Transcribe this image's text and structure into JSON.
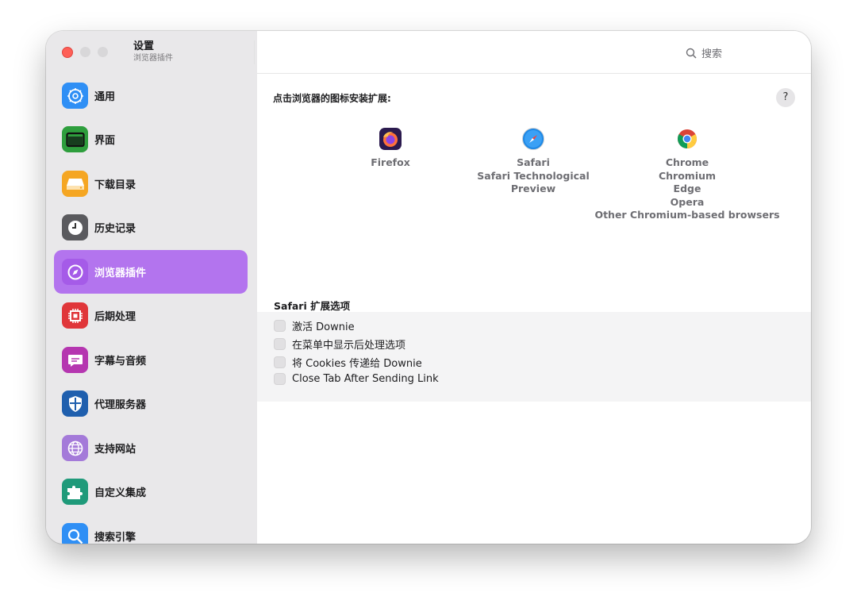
{
  "window": {
    "title": "设置",
    "subtitle": "浏览器插件"
  },
  "search": {
    "label": "搜索"
  },
  "sidebar": {
    "items": [
      {
        "label": "通用",
        "icon": "gear-icon",
        "color": "#2f8ff5",
        "active": false
      },
      {
        "label": "界面",
        "icon": "window-icon",
        "color": "#2e9e3d",
        "active": false
      },
      {
        "label": "下载目录",
        "icon": "drive-icon",
        "color": "#f5a623",
        "active": false
      },
      {
        "label": "历史记录",
        "icon": "clock-icon",
        "color": "#5a5a5e",
        "active": false
      },
      {
        "label": "浏览器插件",
        "icon": "compass-icon",
        "color": "#a55be8",
        "active": true
      },
      {
        "label": "后期处理",
        "icon": "chip-icon",
        "color": "#e0363a",
        "active": false
      },
      {
        "label": "字幕与音频",
        "icon": "speech-bubble-icon",
        "color": "#b536b0",
        "active": false
      },
      {
        "label": "代理服务器",
        "icon": "shield-icon",
        "color": "#1f5fae",
        "active": false
      },
      {
        "label": "支持网站",
        "icon": "globe-icon",
        "color": "#a47ad9",
        "active": false
      },
      {
        "label": "自定义集成",
        "icon": "puzzle-icon",
        "color": "#1f9a7a",
        "active": false
      },
      {
        "label": "搜索引擎",
        "icon": "magnifier-icon",
        "color": "#2f8ff5",
        "active": false
      }
    ]
  },
  "main": {
    "header": "点击浏览器的图标安装扩展:",
    "help_label": "?",
    "browsers": [
      {
        "icon": "firefox-icon",
        "names": [
          "Firefox"
        ]
      },
      {
        "icon": "safari-icon",
        "names": [
          "Safari",
          "Safari Technological Preview"
        ]
      },
      {
        "icon": "chrome-icon",
        "names": [
          "Chrome",
          "Chromium",
          "Edge",
          "Opera",
          "Other Chromium-based browsers"
        ]
      }
    ],
    "safari_section_title": "Safari 扩展选项",
    "options": [
      {
        "label": "激活 Downie",
        "checked": false
      },
      {
        "label": "在菜单中显示后处理选项",
        "checked": false
      },
      {
        "label": "将 Cookies 传递给 Downie",
        "checked": false
      },
      {
        "label": "Close Tab After Sending Link",
        "checked": false
      }
    ]
  },
  "colors": {
    "accent": "#b374ee",
    "close_button": "#fe5f57"
  }
}
